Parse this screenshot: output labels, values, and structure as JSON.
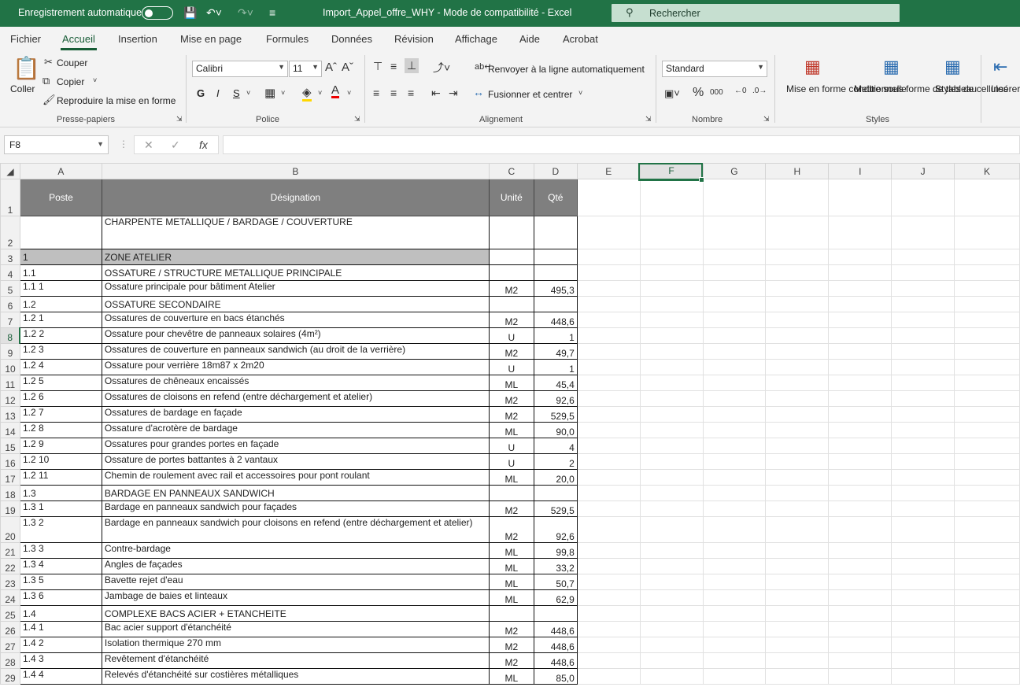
{
  "titlebar": {
    "autosave_label": "Enregistrement automatique",
    "doc_title": "Import_Appel_offre_WHY  -  Mode de compatibilité  -  Excel",
    "search_placeholder": "Rechercher"
  },
  "tabs": [
    "Fichier",
    "Accueil",
    "Insertion",
    "Mise en page",
    "Formules",
    "Données",
    "Révision",
    "Affichage",
    "Aide",
    "Acrobat"
  ],
  "ribbon": {
    "clipboard": {
      "paste": "Coller",
      "cut": "Couper",
      "copy": "Copier",
      "format_painter": "Reproduire la mise en forme",
      "label": "Presse-papiers"
    },
    "font": {
      "name": "Calibri",
      "size": "11",
      "bold": "G",
      "italic": "I",
      "underline": "S",
      "label": "Police"
    },
    "alignment": {
      "wrap": "Renvoyer à la ligne automatiquement",
      "merge": "Fusionner et centrer",
      "label": "Alignement"
    },
    "number": {
      "format": "Standard",
      "label": "Nombre"
    },
    "styles": {
      "conditional": "Mise en forme conditionnelle",
      "as_table": "Mettre sous forme de tableau",
      "cell_styles": "Styles de cellules",
      "label": "Styles"
    },
    "cells": {
      "insert": "Insérer"
    }
  },
  "formula": {
    "namebox": "F8",
    "content": ""
  },
  "columns": [
    "A",
    "B",
    "C",
    "D",
    "E",
    "F",
    "G",
    "H",
    "I",
    "J",
    "K"
  ],
  "header": {
    "poste": "Poste",
    "designation": "Désignation",
    "unite": "Unité",
    "qte": "Qté"
  },
  "rows": [
    {
      "n": "2",
      "a": "",
      "b": "CHARPENTE METALLIQUE / BARDAGE / COUVERTURE",
      "c": "",
      "d": "",
      "kind": "title"
    },
    {
      "n": "3",
      "a": "1",
      "b": "ZONE ATELIER",
      "c": "",
      "d": "",
      "kind": "zone"
    },
    {
      "n": "4",
      "a": "1.1",
      "b": "OSSATURE / STRUCTURE METALLIQUE PRINCIPALE",
      "c": "",
      "d": "",
      "kind": "section"
    },
    {
      "n": "5",
      "a": "1.1 1",
      "b": "Ossature principale pour bâtiment Atelier",
      "c": "M2",
      "d": "495,3",
      "kind": "item"
    },
    {
      "n": "6",
      "a": "1.2",
      "b": "OSSATURE SECONDAIRE",
      "c": "",
      "d": "",
      "kind": "section"
    },
    {
      "n": "7",
      "a": "1.2 1",
      "b": "Ossatures de couverture en bacs étanchés",
      "c": "M2",
      "d": "448,6",
      "kind": "item"
    },
    {
      "n": "8",
      "a": "1.2 2",
      "b": "Ossature pour chevêtre de panneaux solaires (4m²)",
      "c": "U",
      "d": "1",
      "kind": "item"
    },
    {
      "n": "9",
      "a": "1.2 3",
      "b": "Ossatures de couverture en panneaux sandwich (au droit de la verrière)",
      "c": "M2",
      "d": "49,7",
      "kind": "item"
    },
    {
      "n": "10",
      "a": "1.2 4",
      "b": "Ossature pour verrière 18m87 x 2m20",
      "c": "U",
      "d": "1",
      "kind": "item"
    },
    {
      "n": "11",
      "a": "1.2 5",
      "b": "Ossatures de chêneaux encaissés",
      "c": "ML",
      "d": "45,4",
      "kind": "item"
    },
    {
      "n": "12",
      "a": "1.2 6",
      "b": "Ossatures de cloisons en refend (entre déchargement et atelier)",
      "c": "M2",
      "d": "92,6",
      "kind": "item"
    },
    {
      "n": "13",
      "a": "1.2 7",
      "b": "Ossatures de bardage en façade",
      "c": "M2",
      "d": "529,5",
      "kind": "item"
    },
    {
      "n": "14",
      "a": "1.2 8",
      "b": "Ossature d'acrotère de bardage",
      "c": "ML",
      "d": "90,0",
      "kind": "item"
    },
    {
      "n": "15",
      "a": "1.2 9",
      "b": "Ossatures pour grandes portes en façade",
      "c": "U",
      "d": "4",
      "kind": "item"
    },
    {
      "n": "16",
      "a": "1.2 10",
      "b": "Ossature de portes battantes à 2 vantaux",
      "c": "U",
      "d": "2",
      "kind": "item"
    },
    {
      "n": "17",
      "a": "1.2 11",
      "b": "Chemin de roulement avec rail et accessoires pour pont roulant",
      "c": "ML",
      "d": "20,0",
      "kind": "item"
    },
    {
      "n": "18",
      "a": "1.3",
      "b": "BARDAGE EN PANNEAUX SANDWICH",
      "c": "",
      "d": "",
      "kind": "section"
    },
    {
      "n": "19",
      "a": "1.3 1",
      "b": "Bardage en panneaux sandwich pour façades",
      "c": "M2",
      "d": "529,5",
      "kind": "item"
    },
    {
      "n": "20",
      "a": "1.3 2",
      "b": "Bardage en panneaux sandwich pour cloisons en refend (entre déchargement et atelier)",
      "c": "M2",
      "d": "92,6",
      "kind": "item"
    },
    {
      "n": "21",
      "a": "1.3 3",
      "b": "Contre-bardage",
      "c": "ML",
      "d": "99,8",
      "kind": "item"
    },
    {
      "n": "22",
      "a": "1.3 4",
      "b": "Angles de façades",
      "c": "ML",
      "d": "33,2",
      "kind": "item"
    },
    {
      "n": "23",
      "a": "1.3 5",
      "b": "Bavette rejet d'eau",
      "c": "ML",
      "d": "50,7",
      "kind": "item"
    },
    {
      "n": "24",
      "a": "1.3 6",
      "b": "Jambage de baies et linteaux",
      "c": "ML",
      "d": "62,9",
      "kind": "item"
    },
    {
      "n": "25",
      "a": "1.4",
      "b": "COMPLEXE BACS ACIER + ETANCHEITE",
      "c": "",
      "d": "",
      "kind": "section"
    },
    {
      "n": "26",
      "a": "1.4 1",
      "b": "Bac acier support d'étanchéité",
      "c": "M2",
      "d": "448,6",
      "kind": "item"
    },
    {
      "n": "27",
      "a": "1.4 2",
      "b": "Isolation thermique 270 mm",
      "c": "M2",
      "d": "448,6",
      "kind": "item"
    },
    {
      "n": "28",
      "a": "1.4 3",
      "b": "Revêtement d'étanchéité",
      "c": "M2",
      "d": "448,6",
      "kind": "item"
    },
    {
      "n": "29",
      "a": "1.4 4",
      "b": "Relevés d'étanchéité sur costières métalliques",
      "c": "ML",
      "d": "85,0",
      "kind": "item"
    }
  ]
}
